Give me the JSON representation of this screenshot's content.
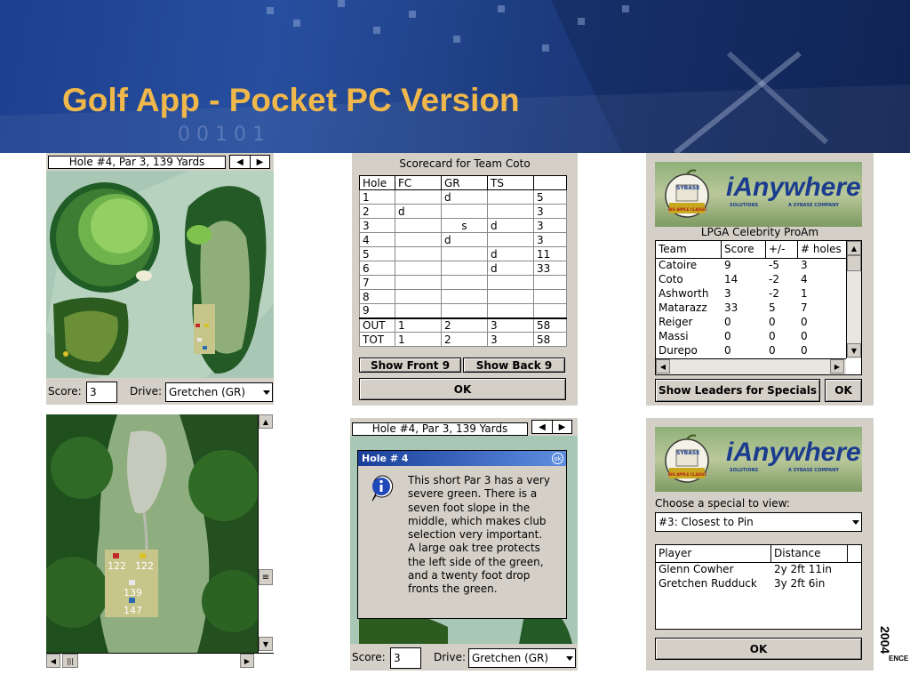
{
  "slide": {
    "title": "Golf App - Pocket PC Version",
    "year": "2004",
    "footer_fragment": "ENCE",
    "colors": {
      "banner": "#1f4190",
      "title": "#f0b84a",
      "window": "#d4d0c8"
    }
  },
  "screen1": {
    "hole_title": "Hole #4, Par 3, 139 Yards",
    "nav_prev": "◀",
    "nav_next": "▶",
    "score_label": "Score:",
    "score_value": "3",
    "drive_label": "Drive:",
    "drive_value": "Gretchen  (GR)"
  },
  "screen2": {
    "title": "Scorecard for Team Coto",
    "columns": [
      "Hole",
      "FC",
      "GR",
      "TS",
      ""
    ],
    "rows": [
      [
        "1",
        "",
        "d",
        "",
        "5"
      ],
      [
        "2",
        "d",
        "",
        "",
        "3"
      ],
      [
        "3",
        "",
        "s",
        "d",
        "3"
      ],
      [
        "4",
        "",
        "d",
        "",
        "3"
      ],
      [
        "5",
        "",
        "",
        "d",
        "11"
      ],
      [
        "6",
        "",
        "",
        "d",
        "33"
      ],
      [
        "7",
        "",
        "",
        "",
        ""
      ],
      [
        "8",
        "",
        "",
        "",
        ""
      ],
      [
        "9",
        "",
        "",
        "",
        ""
      ]
    ],
    "totals": [
      [
        "OUT",
        "1",
        "2",
        "3",
        "58"
      ],
      [
        "TOT",
        "1",
        "2",
        "3",
        "58"
      ]
    ],
    "show_front_label": "Show Front 9",
    "show_back_label": "Show Back 9",
    "ok_label": "OK"
  },
  "screen3": {
    "logo_brand": "iAnywhere",
    "logo_tag": "SOLUTIONS",
    "logo_company": "A SYBASE COMPANY",
    "logo_sybase": "SYBASE",
    "logo_classic": "BIG APPLE CLASSIC",
    "title": "LPGA Celebrity ProAm",
    "columns": [
      "Team",
      "Score",
      "+/-",
      "# holes"
    ],
    "rows": [
      [
        "Catoire",
        "9",
        "-5",
        "3"
      ],
      [
        "Coto",
        "14",
        "-2",
        "4"
      ],
      [
        "Ashworth",
        "3",
        "-2",
        "1"
      ],
      [
        "Matarazz",
        "33",
        "5",
        "7"
      ],
      [
        "Reiger",
        "0",
        "0",
        "0"
      ],
      [
        "Massi",
        "0",
        "0",
        "0"
      ],
      [
        "Durepo",
        "0",
        "0",
        "0"
      ]
    ],
    "leaders_label": "Show Leaders for Specials",
    "ok_label": "OK"
  },
  "screen4": {
    "hole_labels": [
      "122",
      "122",
      "139",
      "147"
    ],
    "tee_colors": [
      "#c0282a",
      "#d8c028",
      "#e8e8e8",
      "#2a6ab0"
    ]
  },
  "screen5": {
    "hole_title": "Hole #4, Par 3, 139 Yards",
    "nav_prev": "◀",
    "nav_next": "▶",
    "dialog_title": "Hole # 4",
    "dialog_close": "ok",
    "dialog_lines": [
      "This short Par 3 has a very",
      "severe green.  There is a",
      "seven foot slope in the",
      "middle, which makes club",
      "selection very important.",
      "A large oak tree protects",
      "the left side of the green,",
      "and a twenty foot drop",
      "fronts the green."
    ],
    "score_label": "Score:",
    "score_value": "3",
    "drive_label": "Drive:",
    "drive_value": "Gretchen  (GR)"
  },
  "screen6": {
    "logo_brand": "iAnywhere",
    "logo_tag": "SOLUTIONS",
    "logo_company": "A SYBASE COMPANY",
    "logo_sybase": "SYBASE",
    "logo_classic": "BIG APPLE CLASSIC",
    "choose_label": "Choose a special to view:",
    "special_value": "#3: Closest to Pin",
    "columns": [
      "Player",
      "Distance"
    ],
    "rows": [
      [
        "Glenn Cowher",
        "2y 2ft 11in"
      ],
      [
        "Gretchen Rudduck",
        "3y 2ft 6in"
      ]
    ],
    "ok_label": "OK"
  }
}
